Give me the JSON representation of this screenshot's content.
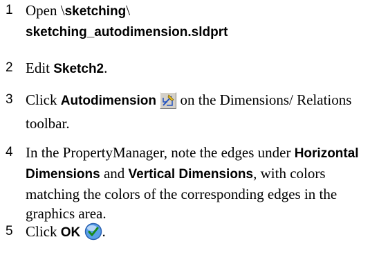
{
  "steps": [
    {
      "number": "1",
      "prefix": "Open \\",
      "bold1": "sketching",
      "mid": "\\",
      "bold2": "sketching_autodimension.sldprt"
    },
    {
      "number": "2",
      "prefix": "Edit ",
      "bold": "Sketch2",
      "suffix": "."
    },
    {
      "number": "3",
      "prefix": "Click ",
      "bold": "Autodimension",
      "icon": "autodimension-icon",
      "suffix": " on the Dimensions/ Relations toolbar."
    },
    {
      "number": "4",
      "prefix": "In the PropertyManager, note the edges under ",
      "bold1": "Horizontal Dimensions",
      "mid": " and ",
      "bold2": "Vertical Dimensions",
      "suffix": ", with colors matching the colors of the corresponding edges in the graphics area."
    },
    {
      "number": "5",
      "prefix": "Click ",
      "bold": "OK",
      "icon": "ok-checkmark-icon",
      "suffix": "."
    }
  ]
}
